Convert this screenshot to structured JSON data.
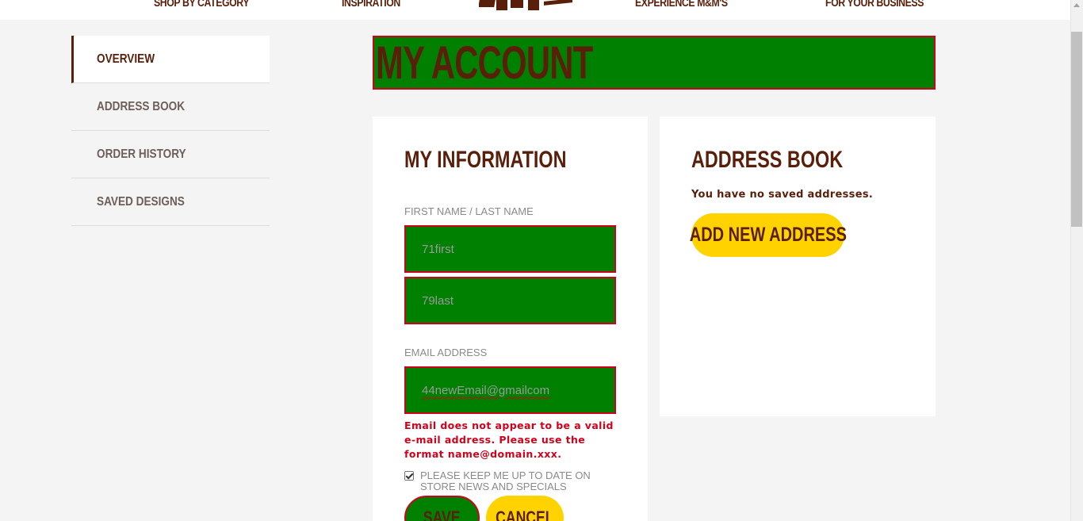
{
  "topnav": {
    "links": [
      "SHOP BY CATEGORY",
      "INSPIRATION",
      "EXPERIENCE M&M'S",
      "FOR YOUR BUSINESS"
    ]
  },
  "sidebar": {
    "items": [
      {
        "label": "OVERVIEW",
        "active": true
      },
      {
        "label": "ADDRESS BOOK",
        "active": false
      },
      {
        "label": "ORDER HISTORY",
        "active": false
      },
      {
        "label": "SAVED DESIGNS",
        "active": false
      }
    ]
  },
  "page": {
    "title": "MY ACCOUNT"
  },
  "info": {
    "heading": "MY INFORMATION",
    "name_label": "FIRST NAME / LAST NAME",
    "first_name": "71first",
    "last_name": "79last",
    "email_label": "EMAIL ADDRESS",
    "email": "44newEmail@gmailcom",
    "error": "Email does not appear to be a valid e-mail address. Please use the format name@domain.xxx.",
    "newsletter_label": "PLEASE KEEP ME UP TO DATE ON STORE NEWS AND SPECIALS",
    "newsletter_checked": true,
    "save_label": "SAVE",
    "cancel_label": "CANCEL"
  },
  "address_book": {
    "heading": "ADDRESS BOOK",
    "empty_text": "You have no saved addresses.",
    "add_label": "ADD NEW ADDRESS"
  },
  "colors": {
    "brand_brown": "#5a1f0a",
    "accent_yellow": "#ffd200",
    "highlight_green": "#008000",
    "error_red": "#d0021b"
  }
}
